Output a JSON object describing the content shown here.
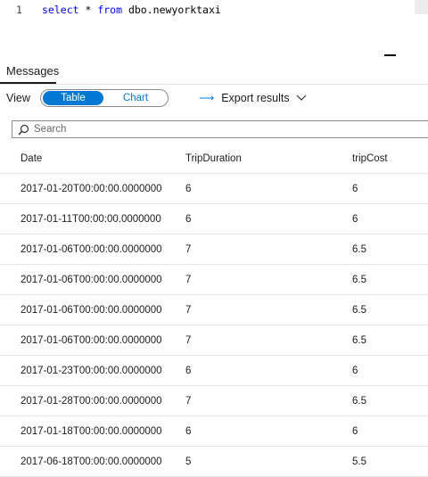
{
  "editor": {
    "line_number": "1",
    "code": {
      "kw1": "select",
      "mid1": " * ",
      "kw2": "from",
      "rest": " dbo.newyorktaxi"
    }
  },
  "results_panel": {
    "tab_label": "Messages",
    "view_label": "View",
    "toggle": {
      "table_label": "Table",
      "chart_label": "Chart",
      "selected": "Table"
    },
    "export_label": "Export results",
    "search": {
      "placeholder": "Search",
      "value": ""
    }
  },
  "table": {
    "columns": [
      "Date",
      "TripDuration",
      "tripCost"
    ],
    "rows": [
      [
        "2017-01-20T00:00:00.0000000",
        "6",
        "6"
      ],
      [
        "2017-01-11T00:00:00.0000000",
        "6",
        "6"
      ],
      [
        "2017-01-06T00:00:00.0000000",
        "7",
        "6.5"
      ],
      [
        "2017-01-06T00:00:00.0000000",
        "7",
        "6.5"
      ],
      [
        "2017-01-06T00:00:00.0000000",
        "7",
        "6.5"
      ],
      [
        "2017-01-06T00:00:00.0000000",
        "7",
        "6.5"
      ],
      [
        "2017-01-23T00:00:00.0000000",
        "6",
        "6"
      ],
      [
        "2017-01-28T00:00:00.0000000",
        "7",
        "6.5"
      ],
      [
        "2017-01-18T00:00:00.0000000",
        "6",
        "6"
      ],
      [
        "2017-06-18T00:00:00.0000000",
        "5",
        "5.5"
      ]
    ]
  },
  "colors": {
    "accent": "#0078d4",
    "keyword": "#0000ff"
  },
  "icons": {
    "search": "search-icon",
    "export": "export-arrow-icon",
    "dropdown": "chevron-down-icon"
  }
}
